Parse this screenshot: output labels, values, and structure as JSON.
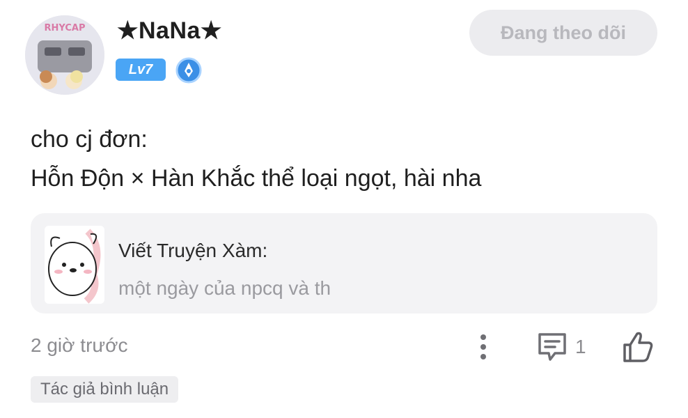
{
  "user": {
    "name": "★NaNa★",
    "avatar_text": "RHYCAP",
    "level": "Lv7"
  },
  "follow_button": {
    "label": "Đang theo dõi"
  },
  "comment": {
    "lines": [
      "cho cj đơn:",
      "Hỗn Độn × Hàn Khắc thể loại ngọt, hài nha"
    ]
  },
  "reference": {
    "title": "Viết Truyện Xàm:",
    "subtitle": "một ngày của npcq và th"
  },
  "meta": {
    "timestamp": "2 giờ trước",
    "reply_count": "1",
    "author_tag": "Tác giả bình luận"
  },
  "icons": {
    "more": "more-vertical-icon",
    "reply": "comment-icon",
    "like": "thumbs-up-icon",
    "rank": "pen-badge-icon"
  },
  "colors": {
    "level_badge": "#4aa5f5",
    "follow_bg": "#ececef",
    "follow_text": "#b8b8bd",
    "card_bg": "#f3f3f5",
    "muted": "#8c8c90"
  }
}
